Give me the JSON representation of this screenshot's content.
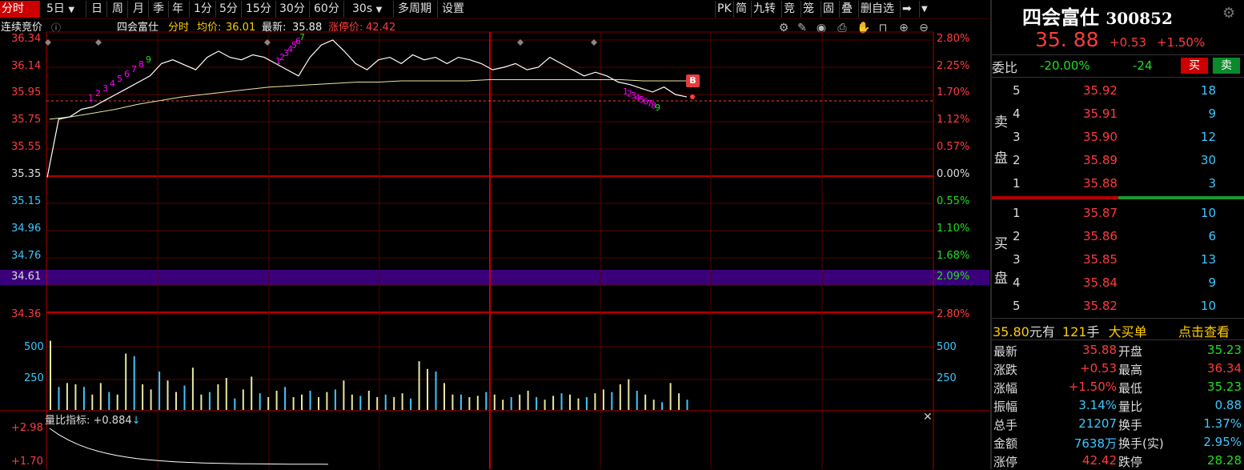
{
  "toolbar": {
    "tabs": [
      "分时",
      "5日",
      "日",
      "周",
      "月",
      "季",
      "年",
      "1分",
      "5分",
      "15分",
      "30分",
      "60分",
      "30s",
      "多周期",
      "设置"
    ],
    "right_buttons": [
      "PK",
      "简",
      "九转",
      "竞",
      "笼",
      "固",
      "叠",
      "删自选"
    ]
  },
  "infoline": {
    "auction_label": "连续竞价",
    "stock_name": "四会富仕",
    "chart_type": "分时",
    "avg_label": "均价:",
    "avg_value": "36.01",
    "latest_label": "最新:",
    "latest_value": "35.88",
    "limit_label": "涨停价:",
    "limit_value": "42.42"
  },
  "price_axis": {
    "left": [
      "36.34",
      "36.14",
      "35.95",
      "35.75",
      "35.55",
      "35.35",
      "35.15",
      "34.96",
      "34.76",
      "34.61"
    ],
    "right": [
      "2.80%",
      "2.25%",
      "1.70%",
      "1.12%",
      "0.57%",
      "0.00%",
      "0.55%",
      "1.10%",
      "1.68%",
      "2.09%"
    ],
    "highlight_price": "34.61",
    "highlight_pct": "2.09%"
  },
  "volume_axis": {
    "left": [
      "34.36",
      "500",
      "250"
    ],
    "right": [
      "2.80%",
      "500",
      "250"
    ]
  },
  "indicator": {
    "label": "量比指标: +0.884",
    "arrow": "↓",
    "axis": [
      "+2.98",
      "+1.70"
    ]
  },
  "markers": {
    "buy_signal": "B",
    "peak_seq": "1 2 3 4 5 6 7",
    "early_seq": "1 2 3 4 5 6 7 8 9",
    "late_seq": "1 2 3 4 5 6 7 8 9"
  },
  "chart_data": {
    "type": "line",
    "title": "四会富仕 分时",
    "ylim": [
      34.36,
      36.34
    ],
    "prev_close": 35.35,
    "series": [
      {
        "name": "价格",
        "values": [
          35.23,
          35.7,
          35.72,
          35.78,
          35.8,
          35.85,
          35.9,
          35.95,
          36.0,
          36.05,
          36.15,
          36.18,
          36.14,
          36.1,
          36.2,
          36.25,
          36.2,
          36.18,
          36.22,
          36.2,
          36.15,
          36.1,
          36.05,
          36.2,
          36.3,
          36.34,
          36.25,
          36.15,
          36.1,
          36.18,
          36.2,
          36.15,
          36.22,
          36.18,
          36.2,
          36.15,
          36.2,
          36.18,
          36.15,
          36.1,
          36.12,
          36.15,
          36.1,
          36.12,
          36.2,
          36.15,
          36.1,
          36.05,
          36.08,
          36.05,
          36.0,
          35.98,
          35.95,
          35.92,
          35.96,
          35.9,
          35.88
        ]
      },
      {
        "name": "均价",
        "values": [
          35.7,
          35.72,
          35.75,
          35.78,
          35.82,
          35.85,
          35.88,
          35.9,
          35.92,
          35.94,
          35.96,
          35.97,
          35.98,
          35.99,
          36.0,
          36.0,
          36.01,
          36.01,
          36.01,
          36.01,
          36.02,
          36.02,
          36.02,
          36.02,
          36.02,
          36.02,
          36.02,
          36.01,
          36.01,
          36.01
        ]
      }
    ],
    "volume": [
      540,
      180,
      210,
      200,
      180,
      120,
      210,
      140,
      120,
      440,
      420,
      200,
      160,
      300,
      230,
      140,
      190,
      330,
      120,
      140,
      200,
      250,
      90,
      160,
      260,
      130,
      100,
      150,
      180,
      100,
      120,
      150,
      100,
      140,
      160,
      230,
      120,
      110,
      150,
      100,
      120,
      100,
      130,
      90,
      380,
      320,
      300,
      210,
      120,
      120,
      100,
      110,
      140,
      120,
      80,
      100,
      120,
      150,
      100,
      80,
      110,
      130,
      120,
      90,
      100,
      130,
      160,
      140,
      200,
      240,
      150,
      120,
      80,
      60,
      210,
      130,
      80
    ],
    "volume_ylim": [
      0,
      750
    ]
  },
  "right_panel": {
    "stock_name": "四会富仕",
    "stock_code": "300852",
    "price": "35. 88",
    "change": "+0.53",
    "change_pct": "+1.50%",
    "weibi_label": "委比",
    "weibi_pct": "-20.00%",
    "weibi_val": "-24",
    "buy_btn": "买",
    "sell_btn": "卖",
    "sell_label": [
      "卖",
      "盘"
    ],
    "buy_label": [
      "买",
      "盘"
    ],
    "sells": [
      {
        "level": "5",
        "price": "35.92",
        "vol": "18"
      },
      {
        "level": "4",
        "price": "35.91",
        "vol": "9"
      },
      {
        "level": "3",
        "price": "35.90",
        "vol": "12"
      },
      {
        "level": "2",
        "price": "35.89",
        "vol": "30"
      },
      {
        "level": "1",
        "price": "35.88",
        "vol": "3"
      }
    ],
    "buys": [
      {
        "level": "1",
        "price": "35.87",
        "vol": "10"
      },
      {
        "level": "2",
        "price": "35.86",
        "vol": "6"
      },
      {
        "level": "3",
        "price": "35.85",
        "vol": "13"
      },
      {
        "level": "4",
        "price": "35.84",
        "vol": "9"
      },
      {
        "level": "5",
        "price": "35.82",
        "vol": "10"
      }
    ],
    "bigorder": {
      "price": "35.80",
      "unit1": "元有",
      "qty": "121",
      "unit2": "手",
      "label": "大买单",
      "link": "点击查看"
    },
    "stats": [
      {
        "l1": "最新",
        "v1": "35.88",
        "l2": "开盘",
        "v2": "35.23"
      },
      {
        "l1": "涨跌",
        "v1": "+0.53",
        "l2": "最高",
        "v2": "36.34"
      },
      {
        "l1": "涨幅",
        "v1": "+1.50%",
        "l2": "最低",
        "v2": "35.23"
      },
      {
        "l1": "振幅",
        "v1": "3.14%",
        "l2": "量比",
        "v2": "0.88"
      },
      {
        "l1": "总手",
        "v1": "21207",
        "l2": "换手",
        "v2": "1.37%"
      },
      {
        "l1": "金额",
        "v1": "7638万",
        "l2": "换手(实)",
        "v2": "2.95%"
      },
      {
        "l1": "涨停",
        "v1": "42.42",
        "l2": "跌停",
        "v2": "28.28"
      }
    ]
  },
  "colors": {
    "up": "#ff3c3c",
    "down": "#22dd22",
    "axis_red": "#b00000",
    "avg_line": "#e8e8a0",
    "price_line": "#ffffff",
    "magenta": "#ff00ff",
    "highlight_bg": "#3a007a"
  }
}
